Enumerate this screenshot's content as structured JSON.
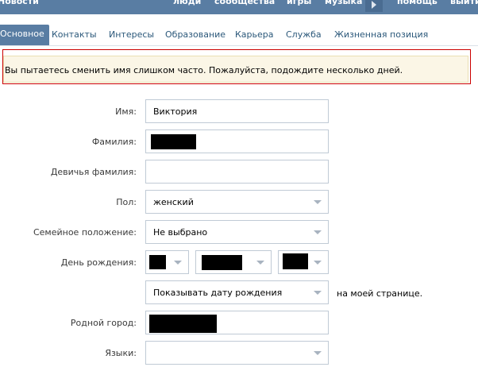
{
  "topnav": {
    "items": [
      "Новости",
      "люди",
      "сообщества",
      "игры",
      "музыка",
      "помощь",
      "выйти"
    ]
  },
  "tabs": [
    {
      "label": "Основное",
      "active": true
    },
    {
      "label": "Контакты"
    },
    {
      "label": "Интересы"
    },
    {
      "label": "Образование"
    },
    {
      "label": "Карьера"
    },
    {
      "label": "Служба"
    },
    {
      "label": "Жизненная позиция"
    }
  ],
  "error": {
    "message": "Вы пытаетесь сменить имя слишком часто. Пожалуйста, подождите несколько дней."
  },
  "form": {
    "first_name": {
      "label": "Имя:",
      "value": "Виктория"
    },
    "last_name": {
      "label": "Фамилия:",
      "value": ""
    },
    "maiden_name": {
      "label": "Девичья фамилия:",
      "value": ""
    },
    "gender": {
      "label": "Пол:",
      "value": "женский"
    },
    "relationship": {
      "label": "Семейное положение:",
      "value": "Не выбрано"
    },
    "birthday": {
      "label": "День рождения:"
    },
    "birthday_visibility": {
      "value": "Показывать дату рождения",
      "suffix": "на моей странице."
    },
    "hometown": {
      "label": "Родной город:",
      "value": ""
    },
    "languages": {
      "label": "Языки:",
      "value": ""
    }
  },
  "colors": {
    "nav_bg": "#597da3",
    "tab_text": "#2b587a",
    "error_border": "#cc0000",
    "error_bg": "#fbf6e6"
  }
}
